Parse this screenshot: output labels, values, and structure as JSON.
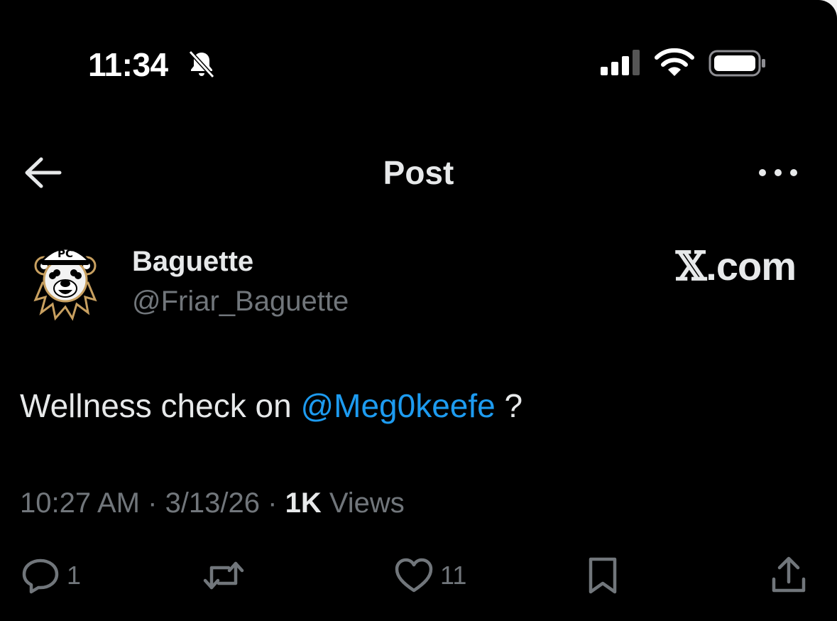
{
  "status_bar": {
    "time": "11:34",
    "icons": [
      "bell-slash-icon",
      "cellular-signal-icon",
      "wifi-icon",
      "battery-icon"
    ]
  },
  "header": {
    "title": "Post",
    "back_icon": "arrow-left-icon",
    "more_icon": "more-horizontal-icon"
  },
  "author": {
    "display_name": "Baguette",
    "handle": "@Friar_Baguette",
    "avatar_cap_text": "PC"
  },
  "watermark": {
    "x_mark": "𝕏",
    "text": ".com"
  },
  "post": {
    "text_before": "Wellness check on ",
    "mention": "@Meg0keefe",
    "text_after": " ?"
  },
  "meta": {
    "time": "10:27 AM",
    "separator": " · ",
    "date": "3/13/26",
    "views_count": "1K",
    "views_label": " Views"
  },
  "actions": {
    "reply_count": "1",
    "like_count": "11"
  },
  "colors": {
    "background": "#000000",
    "text_primary": "#e7e9ea",
    "text_secondary": "#71767b",
    "mention": "#1d9bf0"
  }
}
